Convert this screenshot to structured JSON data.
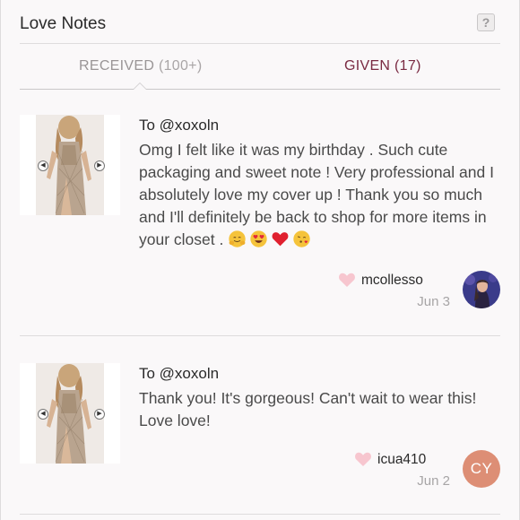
{
  "header": {
    "title": "Love Notes",
    "help_label": "?"
  },
  "tabs": [
    {
      "label": "RECEIVED",
      "count": "(100+)",
      "active": true
    },
    {
      "label": "GIVEN",
      "count": "(17)",
      "active": false
    }
  ],
  "notes": [
    {
      "to": "To @xoxoln",
      "message": "Omg I felt like it was my birthday . Such cute packaging and sweet note ! Very professional and I absolutely love my cover up ! Thank you so much and I'll definitely be back to shop for more items in your closet . ",
      "emojis": [
        "hugging-face",
        "heart-eyes-face",
        "red-heart",
        "face-blowing-kiss"
      ],
      "username": "mcollesso",
      "date": "Jun 3",
      "avatar_type": "photo"
    },
    {
      "to": "To @xoxoln",
      "message": "Thank you! It's gorgeous! Can't wait to wear this! Love love!",
      "emojis": [],
      "username": "icua410",
      "date": "Jun 2",
      "avatar_type": "initials",
      "avatar_initials": "CY"
    }
  ],
  "colors": {
    "background": "#faf8f9",
    "given_tab": "#7a2a42",
    "heart": "#f7c6cf",
    "initials_avatar": "#dd8e75"
  }
}
